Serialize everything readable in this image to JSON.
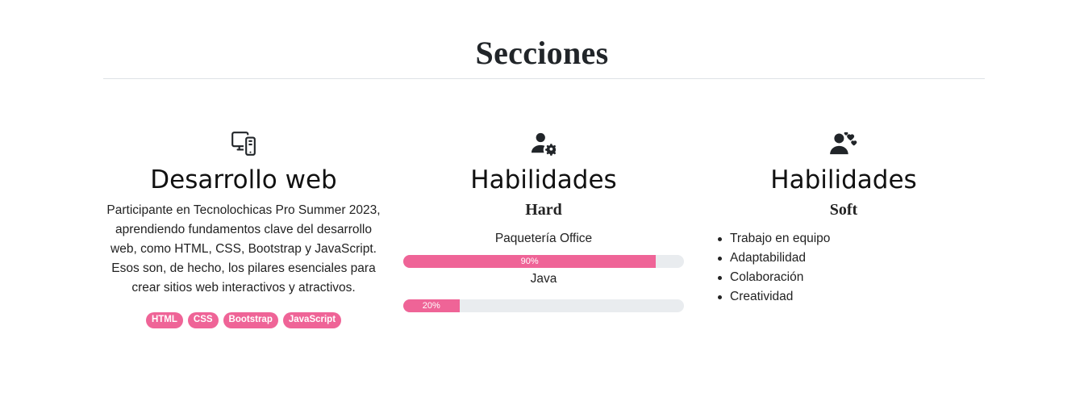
{
  "header": {
    "title": "Secciones"
  },
  "sections": [
    {
      "icon": "devices-icon",
      "title": "Desarrollo web",
      "description": "Participante en Tecnolochicas Pro Summer 2023, aprendiendo fundamentos clave del desarrollo web, como HTML, CSS, Bootstrap y JavaScript. Esos son, de hecho, los pilares esenciales para crear sitios web interactivos y atractivos.",
      "badges": [
        "HTML",
        "CSS",
        "Bootstrap",
        "JavaScript"
      ]
    },
    {
      "icon": "person-gear-icon",
      "title": "Habilidades",
      "subtitle": "Hard",
      "skills": [
        {
          "name": "Paquetería Office",
          "percent": 90,
          "label": "90%"
        },
        {
          "name": "Java",
          "percent": 20,
          "label": "20%"
        }
      ]
    },
    {
      "icon": "person-hearts-icon",
      "title": "Habilidades",
      "subtitle": "Soft",
      "items": [
        "Trabajo en equipo",
        "Adaptabilidad",
        "Colaboración",
        "Creatividad"
      ]
    }
  ],
  "colors": {
    "accent": "#ef6497",
    "track": "#e9ecef",
    "text": "#212529"
  }
}
